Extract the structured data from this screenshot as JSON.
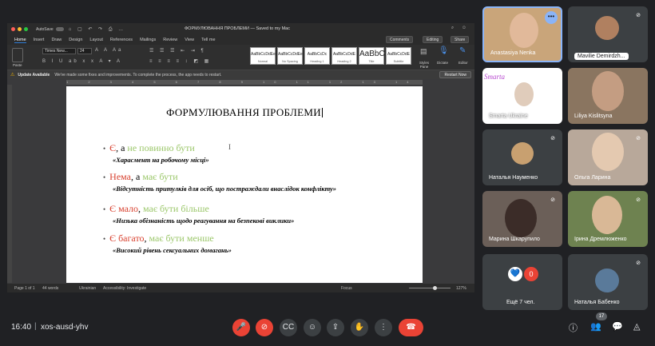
{
  "word": {
    "autosave_label": "AutoSave",
    "toggle_label": "OFF",
    "title": "ФОРМУЛЮВАННЯ ПРОБЛЕМИ — Saved to my Mac",
    "menu": [
      "Home",
      "Insert",
      "Draw",
      "Design",
      "Layout",
      "References",
      "Mailings",
      "Review",
      "View",
      "Tell me"
    ],
    "comments": "Comments",
    "editing": "Editing",
    "share": "Share",
    "paste": "Paste",
    "font": "Times New...",
    "size": "24",
    "styles": [
      {
        "sample": "AaBbCcDdEe",
        "name": "Normal"
      },
      {
        "sample": "AaBbCcDdEe",
        "name": "No Spacing"
      },
      {
        "sample": "AaBbCcDc",
        "name": "Heading 1"
      },
      {
        "sample": "AaBbCcDdE",
        "name": "Heading 2"
      },
      {
        "sample": "AaBbC",
        "name": "Title"
      },
      {
        "sample": "AaBbCcDdE",
        "name": "Subtitle"
      }
    ],
    "styles_pane": "Styles Pane",
    "dictate": "Dictate",
    "editor": "Editor",
    "update_title": "Update Available",
    "update_msg": "We've made some fixes and improvements. To complete the process, the app needs to restart.",
    "restart": "Restart Now",
    "ruler": "1 2 3 4 5 6 7 8 9 10 11 12 13 14 15 16 17 18 19 20 21 22 23 24 25 26 27",
    "doc": {
      "title": "ФОРМУЛЮВАННЯ ПРОБЛЕМИ",
      "items": [
        {
          "a": "Є",
          "b": ", а ",
          "c": "не повинно бути",
          "sub": "«Харасмент на робочому місці»"
        },
        {
          "a": "Нема",
          "b": ", а ",
          "c": "має бути",
          "sub": "«Відсутність притулків для осіб, що постраждали внаслідок конфлікту»"
        },
        {
          "a": "Є мало",
          "b": ", ",
          "c": "має бути більше",
          "sub": "«Низька обізнаність щодо реагування на безпекові виклики»"
        },
        {
          "a": "Є багато",
          "b": ", ",
          "c": "має бути менше",
          "sub": "«Високий рівень сексуальних домагань»"
        }
      ]
    },
    "status": {
      "page": "Page 1 of 1",
      "words": "44 words",
      "lang": "Ukrainian",
      "access": "Accessibility: Investigate",
      "focus": "Focus",
      "zoom": "127%",
      "zoom_level_pct": 58
    }
  },
  "participants": [
    {
      "name": "Anastasiya Nenka",
      "muted": false
    },
    {
      "name": "Mavilie Demirdzh...",
      "muted": true
    },
    {
      "name": "Smarta Ukraine",
      "muted": false,
      "logo": "Smarta"
    },
    {
      "name": "Liliya Kislitsyna",
      "muted": false
    },
    {
      "name": "Наталья Науменко",
      "muted": true
    },
    {
      "name": "Ольга Ларина",
      "muted": true
    },
    {
      "name": "Марина Шкарупило",
      "muted": true
    },
    {
      "name": "Ірина Дремлюженко",
      "muted": true
    },
    {
      "name": "Ещё 7 чел.",
      "muted": false,
      "count": "0"
    },
    {
      "name": "Наталья Бабенко",
      "muted": true
    }
  ],
  "meet": {
    "time": "16:40",
    "sep": "|",
    "code": "xos-ausd-yhv",
    "people_count": "17"
  },
  "colors": {
    "accent": "#8ab4f8",
    "red": "#ea4335",
    "doc_red": "#d8412f",
    "doc_green": "#9bc76a"
  }
}
